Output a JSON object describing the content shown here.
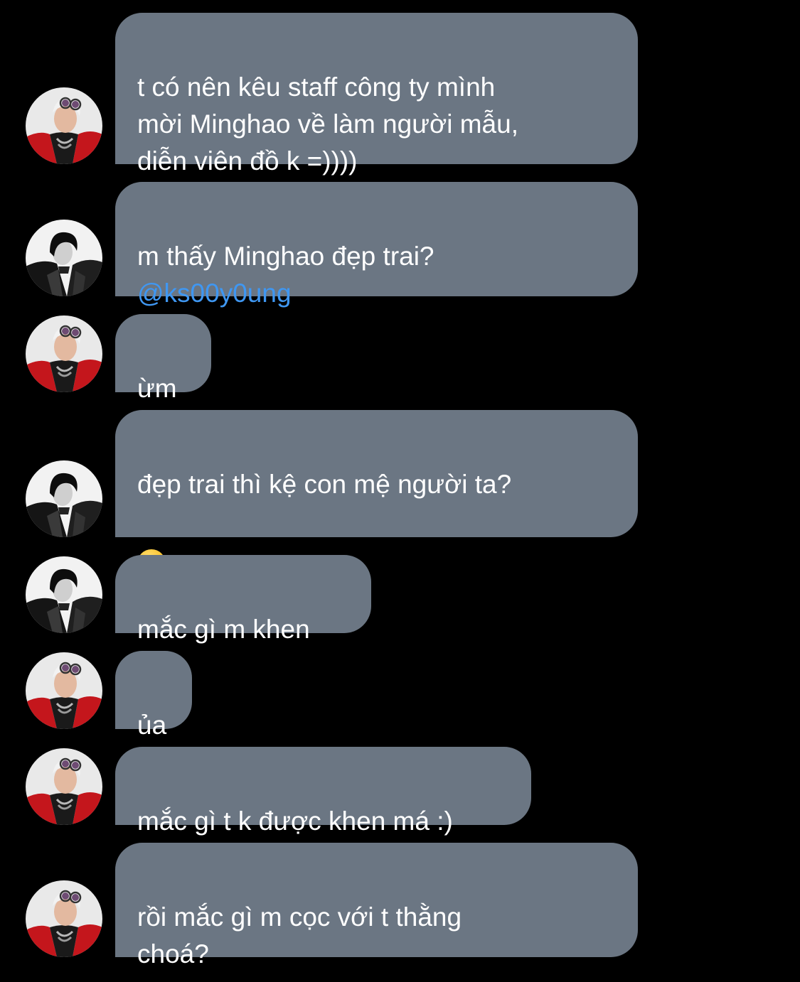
{
  "conversation": {
    "messages": [
      {
        "sender": "red-jacket-user",
        "text": "t có nên kêu staff công ty mình\nmời Minghao về làm người mẫu,\ndiễn viên đồ k =))))"
      },
      {
        "sender": "leather-jacket-user",
        "text": "m thấy Minghao đẹp trai?",
        "mention": "@ks00y0ung"
      },
      {
        "sender": "red-jacket-user",
        "text": "ừm"
      },
      {
        "sender": "leather-jacket-user",
        "text": "đẹp trai thì kệ con mệ người ta?",
        "emoji": "slightly-smiling-face"
      },
      {
        "sender": "leather-jacket-user",
        "text": "mắc gì m khen"
      },
      {
        "sender": "red-jacket-user",
        "text": "ủa"
      },
      {
        "sender": "red-jacket-user",
        "text": "mắc gì t k được khen má :)"
      },
      {
        "sender": "red-jacket-user",
        "text": "rồi mắc gì m cọc với t thằng\nchoá?"
      }
    ]
  },
  "colors": {
    "background": "#000000",
    "bubble": "#6b7683",
    "text": "#ffffff",
    "mention": "#3f97f2"
  }
}
